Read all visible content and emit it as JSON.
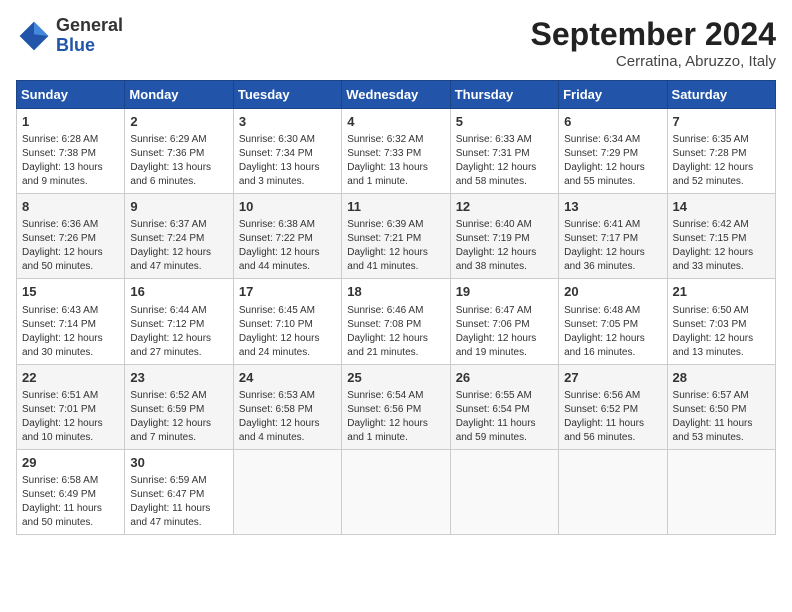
{
  "header": {
    "logo_general": "General",
    "logo_blue": "Blue",
    "month_title": "September 2024",
    "subtitle": "Cerratina, Abruzzo, Italy"
  },
  "days_of_week": [
    "Sunday",
    "Monday",
    "Tuesday",
    "Wednesday",
    "Thursday",
    "Friday",
    "Saturday"
  ],
  "weeks": [
    [
      {
        "day": "1",
        "info": "Sunrise: 6:28 AM\nSunset: 7:38 PM\nDaylight: 13 hours\nand 9 minutes."
      },
      {
        "day": "2",
        "info": "Sunrise: 6:29 AM\nSunset: 7:36 PM\nDaylight: 13 hours\nand 6 minutes."
      },
      {
        "day": "3",
        "info": "Sunrise: 6:30 AM\nSunset: 7:34 PM\nDaylight: 13 hours\nand 3 minutes."
      },
      {
        "day": "4",
        "info": "Sunrise: 6:32 AM\nSunset: 7:33 PM\nDaylight: 13 hours\nand 1 minute."
      },
      {
        "day": "5",
        "info": "Sunrise: 6:33 AM\nSunset: 7:31 PM\nDaylight: 12 hours\nand 58 minutes."
      },
      {
        "day": "6",
        "info": "Sunrise: 6:34 AM\nSunset: 7:29 PM\nDaylight: 12 hours\nand 55 minutes."
      },
      {
        "day": "7",
        "info": "Sunrise: 6:35 AM\nSunset: 7:28 PM\nDaylight: 12 hours\nand 52 minutes."
      }
    ],
    [
      {
        "day": "8",
        "info": "Sunrise: 6:36 AM\nSunset: 7:26 PM\nDaylight: 12 hours\nand 50 minutes."
      },
      {
        "day": "9",
        "info": "Sunrise: 6:37 AM\nSunset: 7:24 PM\nDaylight: 12 hours\nand 47 minutes."
      },
      {
        "day": "10",
        "info": "Sunrise: 6:38 AM\nSunset: 7:22 PM\nDaylight: 12 hours\nand 44 minutes."
      },
      {
        "day": "11",
        "info": "Sunrise: 6:39 AM\nSunset: 7:21 PM\nDaylight: 12 hours\nand 41 minutes."
      },
      {
        "day": "12",
        "info": "Sunrise: 6:40 AM\nSunset: 7:19 PM\nDaylight: 12 hours\nand 38 minutes."
      },
      {
        "day": "13",
        "info": "Sunrise: 6:41 AM\nSunset: 7:17 PM\nDaylight: 12 hours\nand 36 minutes."
      },
      {
        "day": "14",
        "info": "Sunrise: 6:42 AM\nSunset: 7:15 PM\nDaylight: 12 hours\nand 33 minutes."
      }
    ],
    [
      {
        "day": "15",
        "info": "Sunrise: 6:43 AM\nSunset: 7:14 PM\nDaylight: 12 hours\nand 30 minutes."
      },
      {
        "day": "16",
        "info": "Sunrise: 6:44 AM\nSunset: 7:12 PM\nDaylight: 12 hours\nand 27 minutes."
      },
      {
        "day": "17",
        "info": "Sunrise: 6:45 AM\nSunset: 7:10 PM\nDaylight: 12 hours\nand 24 minutes."
      },
      {
        "day": "18",
        "info": "Sunrise: 6:46 AM\nSunset: 7:08 PM\nDaylight: 12 hours\nand 21 minutes."
      },
      {
        "day": "19",
        "info": "Sunrise: 6:47 AM\nSunset: 7:06 PM\nDaylight: 12 hours\nand 19 minutes."
      },
      {
        "day": "20",
        "info": "Sunrise: 6:48 AM\nSunset: 7:05 PM\nDaylight: 12 hours\nand 16 minutes."
      },
      {
        "day": "21",
        "info": "Sunrise: 6:50 AM\nSunset: 7:03 PM\nDaylight: 12 hours\nand 13 minutes."
      }
    ],
    [
      {
        "day": "22",
        "info": "Sunrise: 6:51 AM\nSunset: 7:01 PM\nDaylight: 12 hours\nand 10 minutes."
      },
      {
        "day": "23",
        "info": "Sunrise: 6:52 AM\nSunset: 6:59 PM\nDaylight: 12 hours\nand 7 minutes."
      },
      {
        "day": "24",
        "info": "Sunrise: 6:53 AM\nSunset: 6:58 PM\nDaylight: 12 hours\nand 4 minutes."
      },
      {
        "day": "25",
        "info": "Sunrise: 6:54 AM\nSunset: 6:56 PM\nDaylight: 12 hours\nand 1 minute."
      },
      {
        "day": "26",
        "info": "Sunrise: 6:55 AM\nSunset: 6:54 PM\nDaylight: 11 hours\nand 59 minutes."
      },
      {
        "day": "27",
        "info": "Sunrise: 6:56 AM\nSunset: 6:52 PM\nDaylight: 11 hours\nand 56 minutes."
      },
      {
        "day": "28",
        "info": "Sunrise: 6:57 AM\nSunset: 6:50 PM\nDaylight: 11 hours\nand 53 minutes."
      }
    ],
    [
      {
        "day": "29",
        "info": "Sunrise: 6:58 AM\nSunset: 6:49 PM\nDaylight: 11 hours\nand 50 minutes."
      },
      {
        "day": "30",
        "info": "Sunrise: 6:59 AM\nSunset: 6:47 PM\nDaylight: 11 hours\nand 47 minutes."
      },
      {
        "day": "",
        "info": ""
      },
      {
        "day": "",
        "info": ""
      },
      {
        "day": "",
        "info": ""
      },
      {
        "day": "",
        "info": ""
      },
      {
        "day": "",
        "info": ""
      }
    ]
  ]
}
